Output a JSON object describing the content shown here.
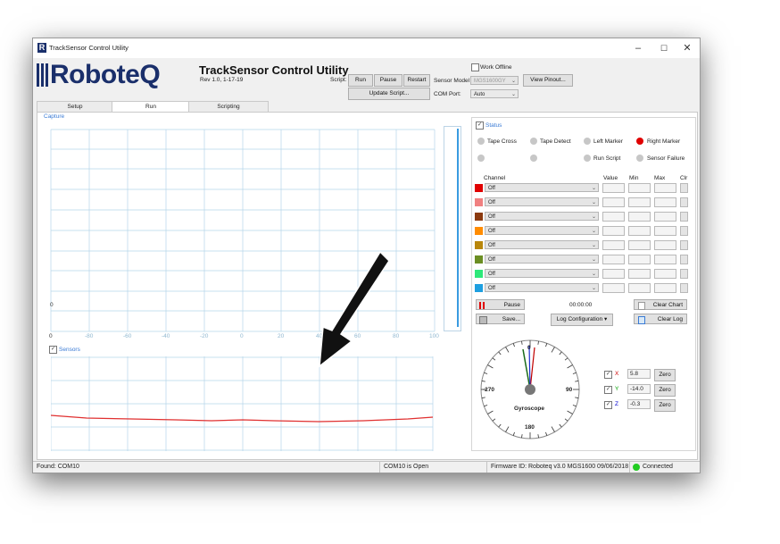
{
  "window": {
    "title": "TrackSensor Control Utility",
    "minimize": "–",
    "maximize": "☐",
    "close": "✕"
  },
  "logo": {
    "text": "RoboteQ"
  },
  "header": {
    "title": "TrackSensor Control Utility",
    "rev": "Rev 1.0, 1-17-19"
  },
  "script": {
    "label": "Script:",
    "run": "Run",
    "pause": "Pause",
    "restart": "Restart",
    "update": "Update Script..."
  },
  "sensor": {
    "model_label": "Sensor Model",
    "model_value": "MGS1600GY",
    "view_pinout": "View Pinout...",
    "com_label": "COM Port:",
    "com_value": "Auto",
    "work_offline": "Work Offline"
  },
  "tabs": [
    "Setup",
    "Run",
    "Scripting"
  ],
  "capture": {
    "label": "Capture",
    "y_marker": "0",
    "x_ticks": [
      "0",
      "-80",
      "-60",
      "-40",
      "-20",
      "0",
      "20",
      "40",
      "60",
      "80",
      "100"
    ]
  },
  "sensors_panel": {
    "label": "Sensors",
    "checked": true
  },
  "status": {
    "label": "Status",
    "items": [
      {
        "label": "Tape Cross",
        "color": "#c7c7c7"
      },
      {
        "label": "Tape Detect",
        "color": "#c7c7c7"
      },
      {
        "label": "Left Marker",
        "color": "#c7c7c7"
      },
      {
        "label": "Right Marker",
        "color": "#e00000"
      },
      {
        "label": "",
        "color": "#c7c7c7"
      },
      {
        "label": "",
        "color": "#c7c7c7"
      },
      {
        "label": "Run Script",
        "color": "#c7c7c7"
      },
      {
        "label": "Sensor Failure",
        "color": "#c7c7c7"
      }
    ]
  },
  "channels": {
    "headers": {
      "channel": "Channel",
      "value": "Value",
      "min": "Min",
      "max": "Max",
      "clr": "Clr"
    },
    "rows": [
      {
        "color": "#e00000",
        "value": "Off"
      },
      {
        "color": "#f08080",
        "value": "Off"
      },
      {
        "color": "#8b3a0f",
        "value": "Off"
      },
      {
        "color": "#ff8c00",
        "value": "Off"
      },
      {
        "color": "#b8860b",
        "value": "Off"
      },
      {
        "color": "#6b8e23",
        "value": "Off"
      },
      {
        "color": "#2ee87a",
        "value": "Off"
      },
      {
        "color": "#1e9fe0",
        "value": "Off"
      }
    ]
  },
  "log": {
    "pause": "Pause",
    "time": "00:00:00",
    "clear_chart": "Clear Chart",
    "save": "Save...",
    "log_config": "Log Configuration",
    "clear_log": "Clear Log"
  },
  "gyro": {
    "label": "Gyroscope",
    "dial_labels": {
      "top": "0",
      "left": "-270",
      "right": "90",
      "bottom": "180"
    },
    "axes": [
      {
        "name": "X",
        "value": "5.8",
        "zero": "Zero",
        "color": "#d00000"
      },
      {
        "name": "Y",
        "value": "-14.0",
        "zero": "Zero",
        "color": "#00a000"
      },
      {
        "name": "Z",
        "value": "-0.3",
        "zero": "Zero",
        "color": "#0000d0"
      }
    ]
  },
  "statusbar": {
    "found": "Found: COM10",
    "com": "COM10 is Open",
    "firmware": "Firmware ID: Roboteq v3.0 MGS1600 09/06/2018",
    "connected": "Connected"
  }
}
